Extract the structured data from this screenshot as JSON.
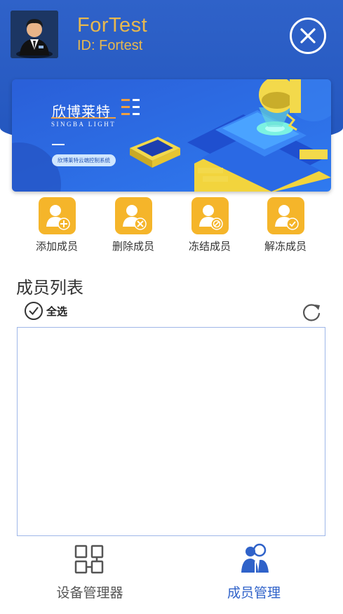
{
  "header": {
    "title": "ForTest",
    "user_id": "ID: Fortest"
  },
  "banner": {
    "brand": "欣博莱特",
    "brand_en": "SINGBA LIGHT",
    "tagline": "欣博莱特云端控制系统"
  },
  "actions": [
    {
      "label": "添加成员",
      "icon": "add-member-icon"
    },
    {
      "label": "删除成员",
      "icon": "delete-member-icon"
    },
    {
      "label": "冻结成员",
      "icon": "freeze-member-icon"
    },
    {
      "label": "解冻成员",
      "icon": "unfreeze-member-icon"
    }
  ],
  "member_list": {
    "title": "成员列表",
    "select_all": "全选",
    "items": []
  },
  "bottom_nav": [
    {
      "label": "设备管理器",
      "icon": "device-manager-icon",
      "active": false
    },
    {
      "label": "成员管理",
      "icon": "member-management-icon",
      "active": true
    }
  ],
  "colors": {
    "header": "#2f62c9",
    "accent_gold": "#e8b84e",
    "action_orange": "#f5b52a",
    "nav_active": "#2f62c9",
    "nav_inactive": "#555555"
  }
}
